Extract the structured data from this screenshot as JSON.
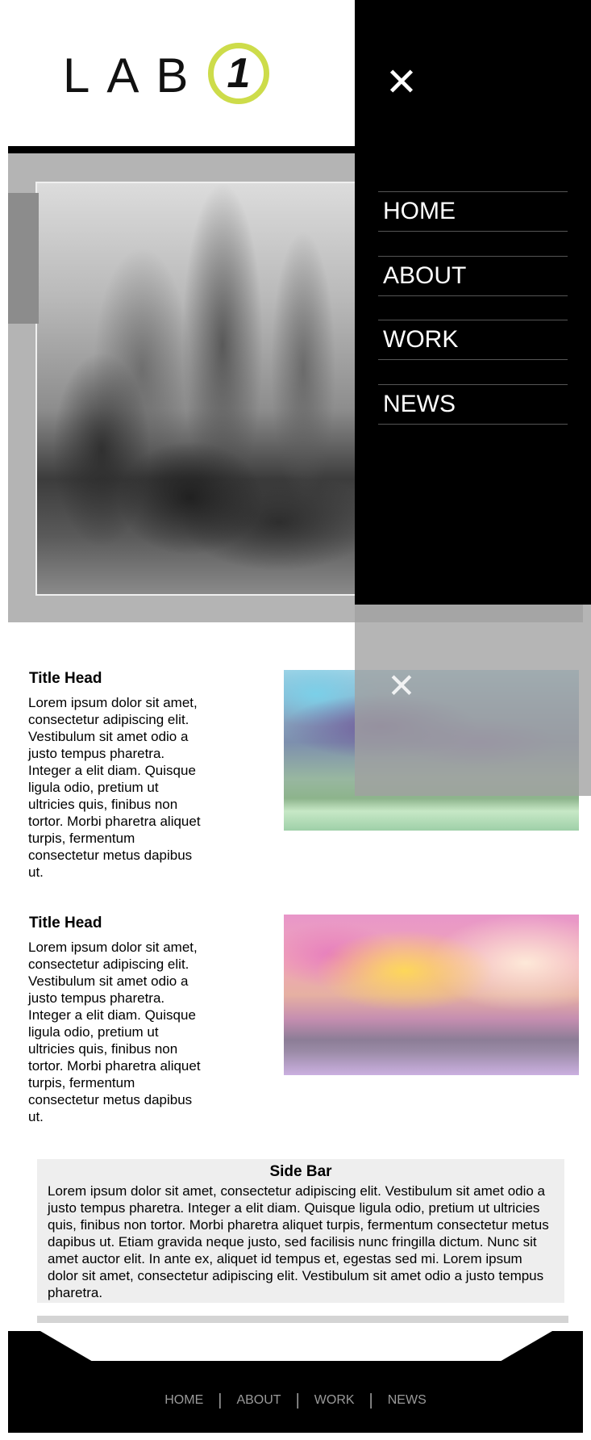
{
  "header": {
    "logo_text": "LAB",
    "logo_number": "1",
    "logo_ring_color": "#cddc4a"
  },
  "nav": {
    "close_icon": "close-icon",
    "items": [
      {
        "label": "HOME"
      },
      {
        "label": "ABOUT"
      },
      {
        "label": "WORK"
      },
      {
        "label": "NEWS"
      }
    ]
  },
  "sections": [
    {
      "title": "Title Head",
      "body": "Lorem ipsum dolor sit amet, consectetur adipiscing elit. Vestibulum sit amet odio a justo tempus pharetra. Integer a elit diam. Quisque ligula odio, pretium ut ultricies quis, finibus non tortor. Morbi pharetra aliquet turpis, fermentum consectetur metus dapibus ut."
    },
    {
      "title": "Title Head",
      "body": "Lorem ipsum dolor sit amet, consectetur adipiscing elit. Vestibulum sit amet odio a justo tempus pharetra. Integer a elit diam. Quisque ligula odio, pretium ut ultricies quis, finibus non tortor. Morbi pharetra aliquet turpis, fermentum consectetur metus dapibus ut."
    }
  ],
  "sidebar": {
    "title": "Side Bar",
    "body": "Lorem ipsum dolor sit amet, consectetur adipiscing elit. Vestibulum sit amet odio a justo tempus pharetra. Integer a elit diam. Quisque ligula odio, pretium ut ultricies quis, finibus non tortor. Morbi pharetra aliquet turpis, fermentum consectetur metus dapibus ut. Etiam gravida neque justo, sed facilisis nunc fringilla dictum. Nunc sit amet auctor elit. In ante ex, aliquet id tempus et, egestas sed mi. Lorem ipsum dolor sit amet, consectetur adipiscing elit. Vestibulum sit amet odio a justo tempus pharetra."
  },
  "footer": {
    "links": [
      "HOME",
      "ABOUT",
      "WORK",
      "NEWS"
    ],
    "separator": "|"
  }
}
